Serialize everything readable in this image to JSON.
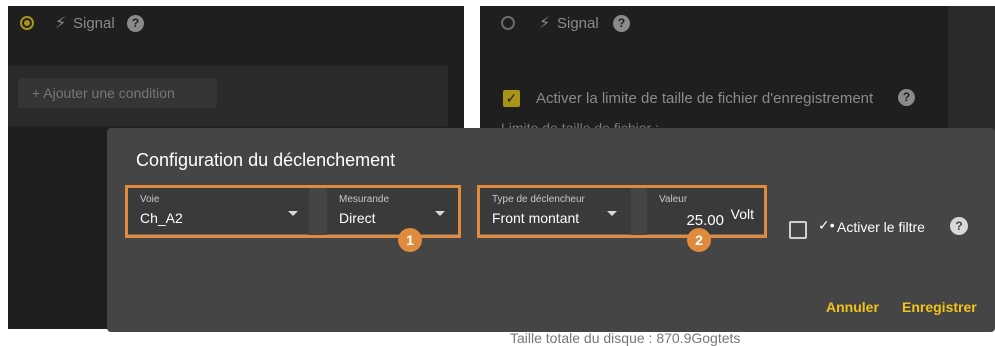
{
  "background": {
    "left_panel": {
      "signal_label": "Signal",
      "add_condition_label": "+ Ajouter une condition"
    },
    "right_panel": {
      "signal_label": "Signal",
      "file_limit_label": "Activer la limite de taille de fichier d'enregistrement",
      "partial_limit_label": "Limite de taille de fichier :",
      "partial_disk_label": "Taille totale du disque : 870.9Gogtets"
    }
  },
  "dialog": {
    "title": "Configuration du déclenchement",
    "group1": {
      "voie": {
        "label": "Voie",
        "value": "Ch_A2"
      },
      "mesurande": {
        "label": "Mesurande",
        "value": "Direct"
      },
      "badge": "1"
    },
    "group2": {
      "type": {
        "label": "Type de déclencheur",
        "value": "Front montant"
      },
      "valeur": {
        "label": "Valeur",
        "value": "25.00",
        "unit": "Volt"
      },
      "badge": "2"
    },
    "filter_label": "Activer le filtre",
    "cancel_label": "Annuler",
    "save_label": "Enregistrer"
  },
  "colors": {
    "accent_gold": "#f2c318",
    "highlight_orange": "#e08a3c",
    "dialog_bg": "#454545"
  },
  "icons": [
    "radio-icon",
    "bolt-icon",
    "help-icon",
    "checkbox-icon",
    "dropdown-arrow-icon",
    "filter-icon"
  ]
}
